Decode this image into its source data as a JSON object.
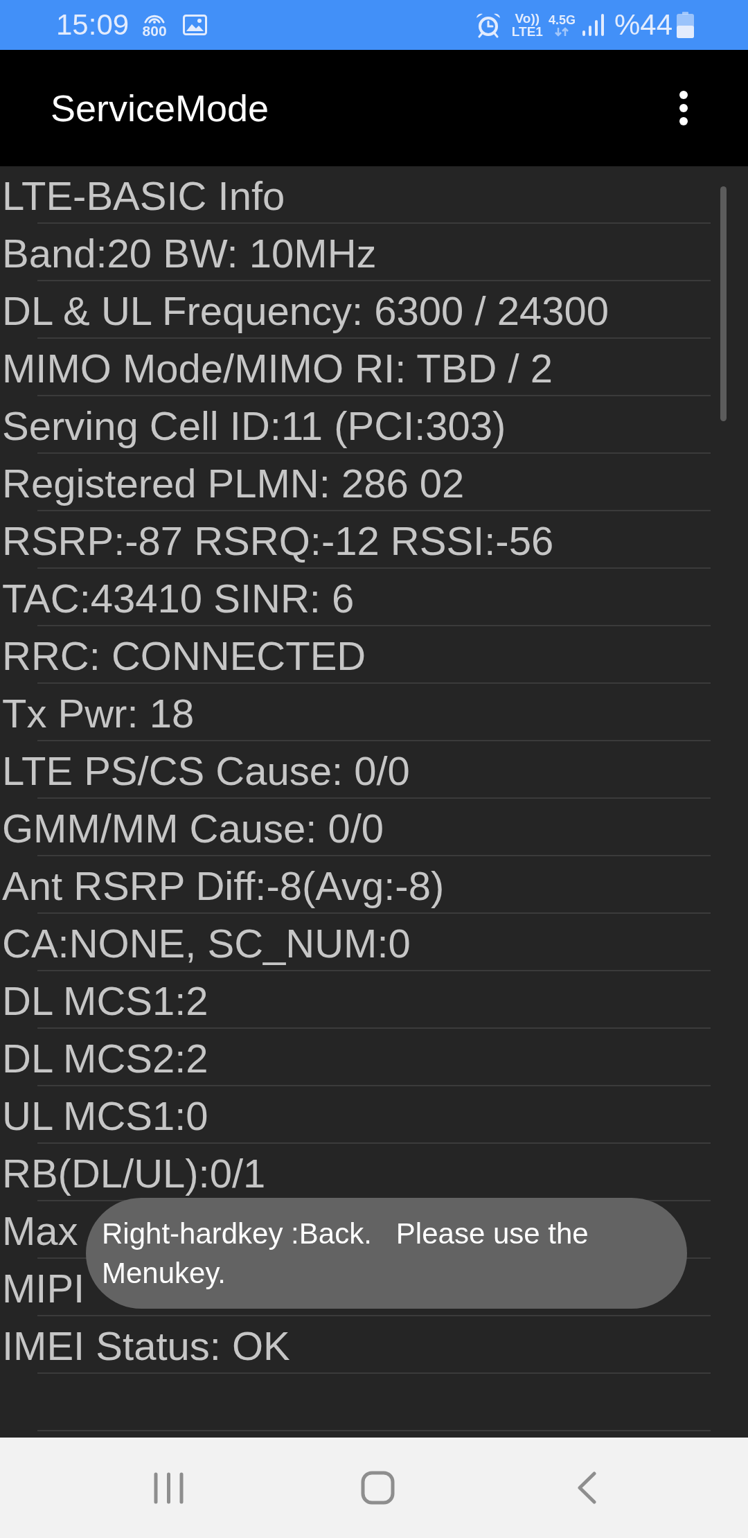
{
  "status_bar": {
    "time": "15:09",
    "call_band": "800",
    "volte": "Vo))",
    "volte_line": "LTE1",
    "network": "4.5G",
    "battery": "%44"
  },
  "app_bar": {
    "title": "ServiceMode"
  },
  "info_rows": [
    "LTE-BASIC Info",
    "Band:20 BW: 10MHz",
    "DL & UL Frequency: 6300 / 24300",
    "MIMO Mode/MIMO RI: TBD / 2",
    "Serving Cell ID:11 (PCI:303)",
    "Registered PLMN: 286 02",
    "RSRP:-87 RSRQ:-12 RSSI:-56",
    "TAC:43410 SINR: 6",
    "RRC: CONNECTED",
    "Tx Pwr: 18",
    "LTE PS/CS Cause: 0/0",
    "GMM/MM Cause: 0/0",
    "Ant RSRP Diff:-8(Avg:-8)",
    "CA:NONE, SC_NUM:0",
    "DL MCS1:2",
    "DL MCS2:2",
    "UL MCS1:0",
    "RB(DL/UL):0/1",
    "Max",
    "MIPI",
    "IMEI Status: OK"
  ],
  "toast": {
    "message": "Right-hardkey :Back.   Please use the Menukey."
  }
}
